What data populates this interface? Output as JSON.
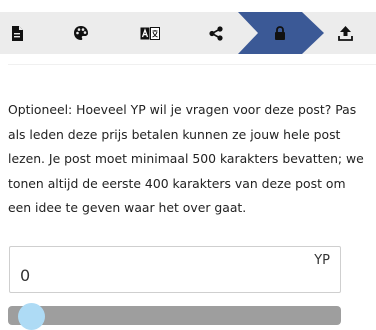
{
  "toolbar": {
    "tabs": [
      {
        "icon": "document-icon",
        "active": false
      },
      {
        "icon": "palette-icon",
        "active": false
      },
      {
        "icon": "translate-icon",
        "active": false
      },
      {
        "icon": "share-icon",
        "active": false
      },
      {
        "icon": "lock-icon",
        "active": true
      },
      {
        "icon": "upload-icon",
        "active": false
      }
    ],
    "active_color": "#3b5996",
    "background": "#ececec"
  },
  "paywall": {
    "description": "Optioneel: Hoeveel YP wil je vragen voor deze post? Pas als leden deze prijs betalen kunnen ze jouw hele post lezen. Je post moet minimaal 500 karakters bevatten; we tonen altijd de eerste 400 karakters van deze post om een idee te geven waar het over gaat.",
    "price_value": "0",
    "price_unit": "YP",
    "slider_value": 0,
    "slider_track_color": "#9e9e9e",
    "slider_handle_color": "#aedbf5"
  }
}
